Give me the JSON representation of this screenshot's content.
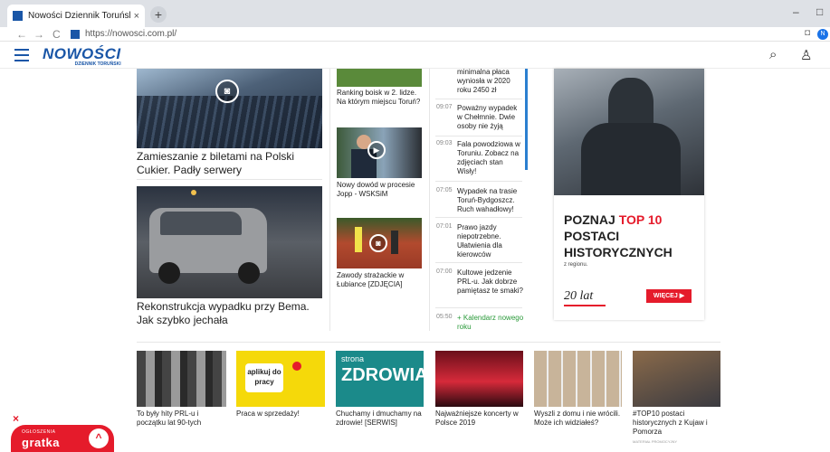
{
  "browser": {
    "tab_title": "Nowości Dziennik Toruński - Dzie",
    "tab_close": "×",
    "new_tab": "+",
    "min": "–",
    "max": "□",
    "back": "←",
    "forward": "→",
    "reload": "C",
    "url": "https://nowosci.com.pl/",
    "camera": "◘",
    "profile": "N"
  },
  "site": {
    "logo": "NOWOŚCI",
    "logo_sub": "DZIENNIK TORUŃSKI",
    "search": "⌕",
    "user": "♙"
  },
  "left_articles": [
    {
      "title": "Zamieszanie z biletami na Polski Cukier. Padły serwery",
      "icon": "camera-icon"
    },
    {
      "title": "Rekonstrukcja wypadku przy Bema. Jak szybko jechała"
    }
  ],
  "mid_articles": [
    {
      "title": "Ranking boisk w 2. lidze. Na którym miejscu Toruń?"
    },
    {
      "title": "Nowy dowód w procesie Jopp - WSKSiM"
    },
    {
      "title": "Zawody strażackie w Łubiance [ZDJĘCIA]"
    }
  ],
  "feed": [
    {
      "time": "",
      "title": "minimalna płaca wyniosła w 2020 roku 2450 zł"
    },
    {
      "time": "09:07",
      "title": "Poważny wypadek w Chełmnie. Dwie osoby nie żyją"
    },
    {
      "time": "09:03",
      "title": "Fala powodziowa w Toruniu. Zobacz na zdjęciach stan Wisły!"
    },
    {
      "time": "07:05",
      "title": "Wypadek na trasie Toruń-Bydgoszcz. Ruch wahadłowy!"
    },
    {
      "time": "07:01",
      "title": "Prawo jazdy niepotrzebne. Ułatwienia dla kierowców"
    },
    {
      "time": "07:00",
      "title": "Kultowe jedzenie PRL-u. Jak dobrze pamiętasz te smaki?"
    },
    {
      "time": "05:50",
      "title": "+ Kalendarz nowego roku"
    }
  ],
  "ad": {
    "title_a": "POZNAJ ",
    "title_red": "TOP 10",
    "title_b": "POSTACI HISTORYCZNYCH",
    "sub": "z regionu.",
    "logo": "20 lat",
    "button": "WIĘCEJ ▶"
  },
  "bottom": [
    {
      "title": "To były hity PRL-u i początku lat 90-tych"
    },
    {
      "title": "Praca w sprzedaży!",
      "img_text": "aplikuj do pracy"
    },
    {
      "title": "Chuchamy i dmuchamy na zdrowie! [SERWIS]",
      "img_text_a": "strona",
      "img_text_b": "ZDROWIA"
    },
    {
      "title": "Najważniejsze koncerty w Polsce 2019"
    },
    {
      "title": "Wyszli z domu i nie wrócili. Może ich widziałeś?"
    },
    {
      "title": "#TOP10 postaci historycznych z Kujaw i Pomorza",
      "tag": "MATERIAŁ PROMOCYJNY"
    }
  ],
  "promo": {
    "small": "OGŁOSZENIA",
    "big": "gratka",
    "arrow": "^",
    "close": "×"
  }
}
